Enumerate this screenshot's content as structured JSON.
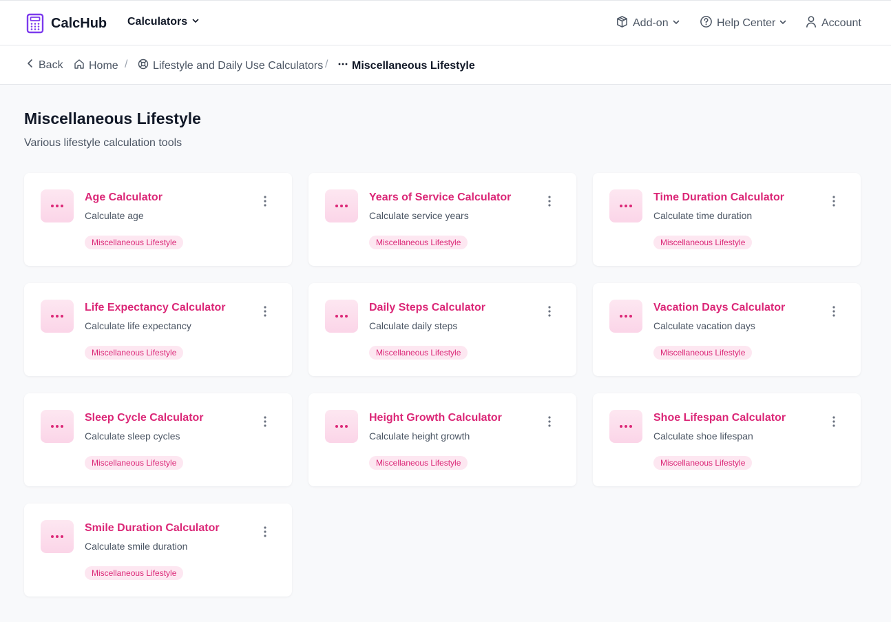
{
  "brand": {
    "name": "CalcHub",
    "icon": "calculator-icon",
    "color": "#7c3aed"
  },
  "nav": {
    "calculators_label": "Calculators",
    "addon_label": "Add-on",
    "help_label": "Help Center",
    "account_label": "Account"
  },
  "breadcrumb": {
    "back_label": "Back",
    "home_label": "Home",
    "category_label": "Lifestyle and Daily Use Calculators",
    "current_label": "Miscellaneous Lifestyle",
    "separator": "/"
  },
  "page": {
    "title": "Miscellaneous Lifestyle",
    "subtitle": "Various lifestyle calculation tools"
  },
  "colors": {
    "accent": "#db2777",
    "tag_bg": "#fde7f1",
    "background": "#f8f9fb"
  },
  "cards": [
    {
      "title": "Age Calculator",
      "description": "Calculate age",
      "tag": "Miscellaneous Lifestyle",
      "icon": "more-horizontal-icon"
    },
    {
      "title": "Years of Service Calculator",
      "description": "Calculate service years",
      "tag": "Miscellaneous Lifestyle",
      "icon": "more-horizontal-icon"
    },
    {
      "title": "Time Duration Calculator",
      "description": "Calculate time duration",
      "tag": "Miscellaneous Lifestyle",
      "icon": "more-horizontal-icon"
    },
    {
      "title": "Life Expectancy Calculator",
      "description": "Calculate life expectancy",
      "tag": "Miscellaneous Lifestyle",
      "icon": "more-horizontal-icon"
    },
    {
      "title": "Daily Steps Calculator",
      "description": "Calculate daily steps",
      "tag": "Miscellaneous Lifestyle",
      "icon": "more-horizontal-icon"
    },
    {
      "title": "Vacation Days Calculator",
      "description": "Calculate vacation days",
      "tag": "Miscellaneous Lifestyle",
      "icon": "more-horizontal-icon"
    },
    {
      "title": "Sleep Cycle Calculator",
      "description": "Calculate sleep cycles",
      "tag": "Miscellaneous Lifestyle",
      "icon": "more-horizontal-icon"
    },
    {
      "title": "Height Growth Calculator",
      "description": "Calculate height growth",
      "tag": "Miscellaneous Lifestyle",
      "icon": "more-horizontal-icon"
    },
    {
      "title": "Shoe Lifespan Calculator",
      "description": "Calculate shoe lifespan",
      "tag": "Miscellaneous Lifestyle",
      "icon": "more-horizontal-icon"
    },
    {
      "title": "Smile Duration Calculator",
      "description": "Calculate smile duration",
      "tag": "Miscellaneous Lifestyle",
      "icon": "more-horizontal-icon"
    }
  ]
}
